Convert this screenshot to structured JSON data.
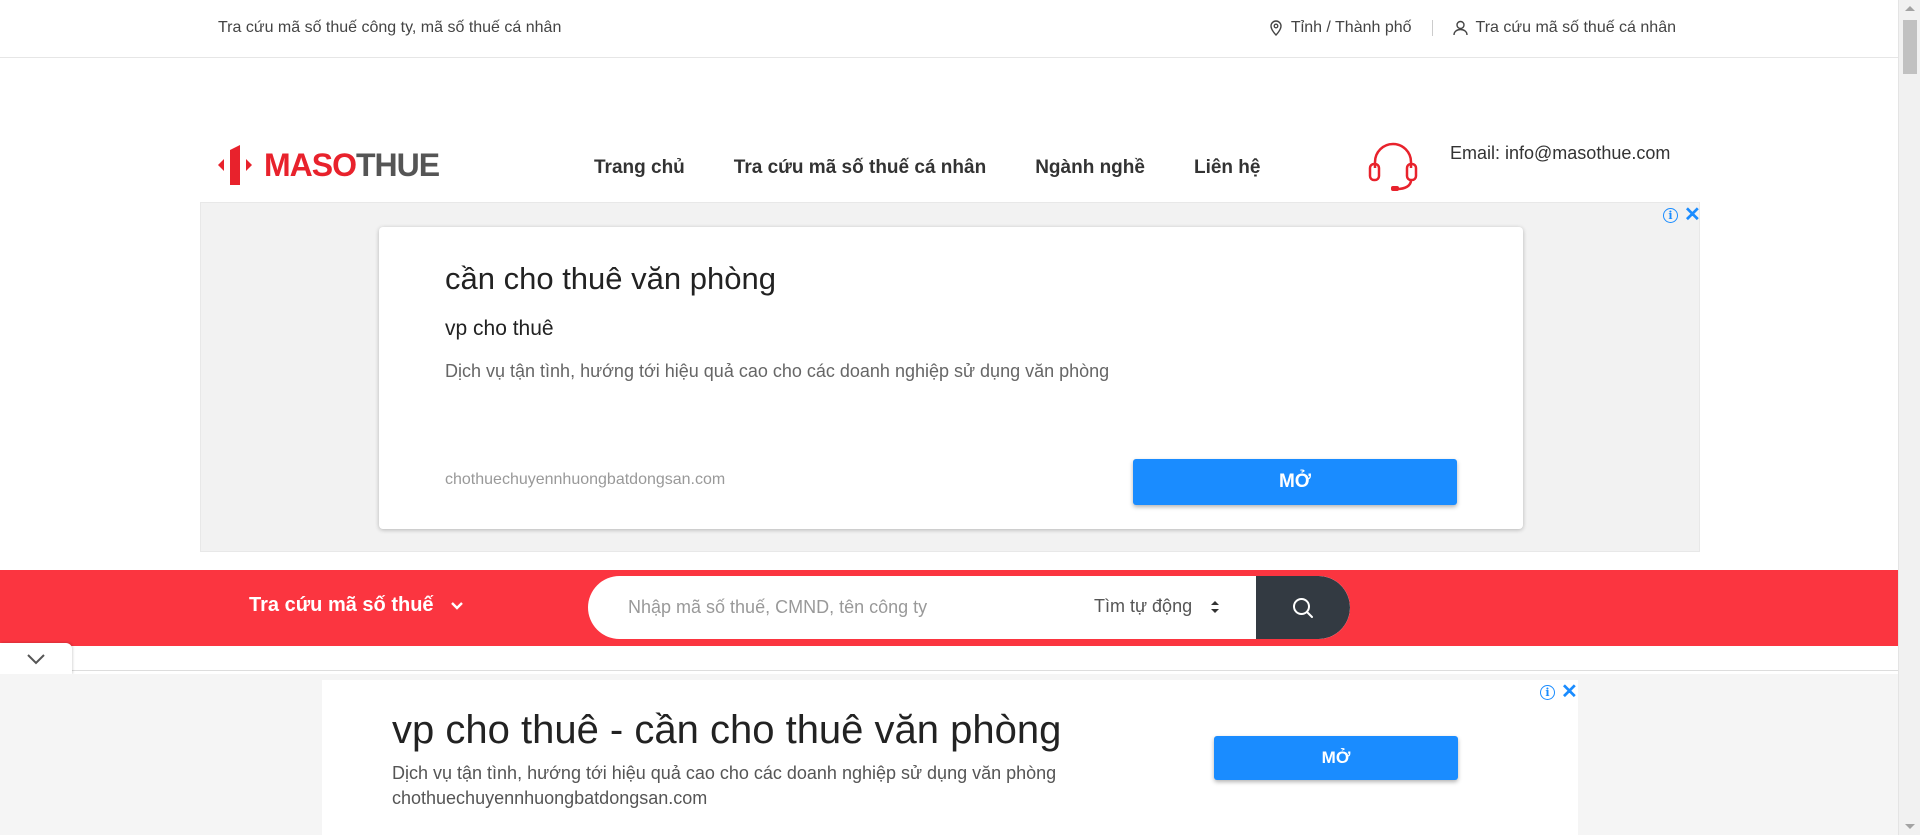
{
  "topbar": {
    "tagline": "Tra cứu mã số thuế công ty, mã số thuế cá nhân",
    "province_link": "Tỉnh / Thành phố",
    "personal_link": "Tra cứu mã số thuế cá nhân"
  },
  "header": {
    "logo_text_red": "MASO",
    "logo_text_gray": "THUE",
    "nav": [
      {
        "label": "Trang chủ"
      },
      {
        "label": "Tra cứu mã số thuế cá nhân"
      },
      {
        "label": "Ngành nghề"
      },
      {
        "label": "Liên hệ"
      }
    ],
    "email": "Email: info@masothue.com"
  },
  "ad_top": {
    "headline": "cần cho thuê văn phòng",
    "subhead": "vp cho thuê",
    "description": "Dịch vụ tận tình, hướng tới hiệu quả cao cho các doanh nghiệp sử dụng văn phòng",
    "domain": "chothuechuyennhuongbatdongsan.com",
    "button": "MỞ"
  },
  "search": {
    "dropdown_label": "Tra cứu mã số thuế",
    "placeholder": "Nhập mã số thuế, CMND, tên công ty",
    "mode_label": "Tìm tự động"
  },
  "ad_bottom": {
    "headline": "vp cho thuê - cần cho thuê văn phòng",
    "description": "Dịch vụ tận tình, hướng tới hiệu quả cao cho các doanh nghiệp sử dụng văn phòng",
    "domain": "chothuechuyennhuongbatdongsan.com",
    "button": "MỞ"
  },
  "colors": {
    "brand_red": "#fb3540",
    "ad_blue": "#1a8cff",
    "search_button": "#333a42"
  },
  "icons": [
    "map-pin-icon",
    "user-icon",
    "headset-icon",
    "chevron-down-icon",
    "search-icon",
    "info-icon",
    "close-icon",
    "sort-icon"
  ]
}
